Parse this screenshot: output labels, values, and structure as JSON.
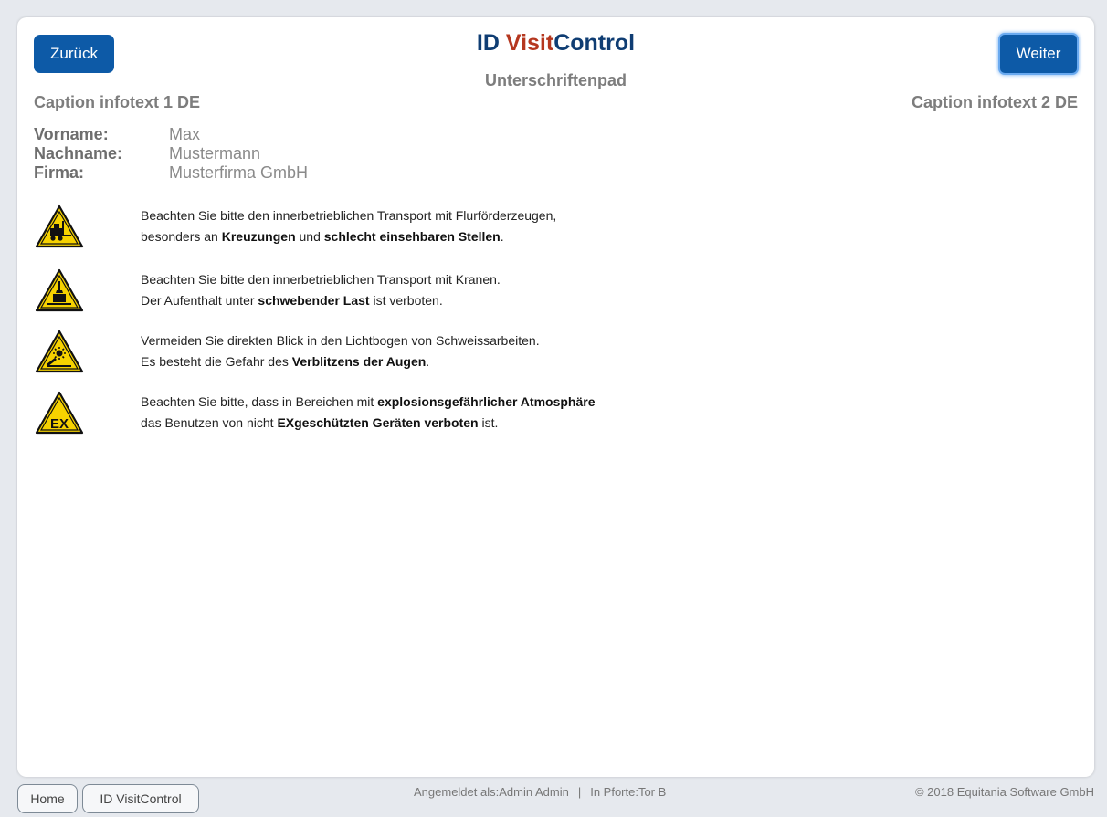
{
  "header": {
    "back_label": "Zurück",
    "next_label": "Weiter",
    "logo_part1": "ID ",
    "logo_part2": "Visit",
    "logo_part3": "Control",
    "subtitle": "Unterschriftenpad",
    "caption_left": "Caption infotext 1 DE",
    "caption_right": "Caption infotext 2 DE"
  },
  "person": {
    "first_name_label": "Vorname:",
    "first_name": "Max",
    "last_name_label": "Nachname:",
    "last_name": "Mustermann",
    "company_label": "Firma:",
    "company": "Musterfirma GmbH"
  },
  "warnings": [
    {
      "icon": "forklift-warning-icon",
      "line1": "Beachten Sie bitte den innerbetrieblichen Transport mit Flurförderzeugen,",
      "line2_pre": "besonders an ",
      "line2_b1": "Kreuzungen",
      "line2_mid": " und ",
      "line2_b2": "schlecht einsehbaren Stellen",
      "line2_post": "."
    },
    {
      "icon": "suspended-load-warning-icon",
      "line1": "Beachten Sie bitte den innerbetrieblichen Transport mit Kranen.",
      "line2_pre": "Der Aufenthalt unter ",
      "line2_b1": "schwebender Last",
      "line2_post": " ist verboten."
    },
    {
      "icon": "welding-arc-warning-icon",
      "line1": "Vermeiden Sie direkten Blick in den Lichtbogen von Schweissarbeiten.",
      "line2_pre": "Es besteht die Gefahr des ",
      "line2_b1": "Verblitzens der Augen",
      "line2_post": "."
    },
    {
      "icon": "explosive-atmosphere-warning-icon",
      "icon_text": "EX",
      "line1_pre": "Beachten Sie bitte, dass in Bereichen mit ",
      "line1_b": "explosionsgefährlicher Atmosphäre",
      "line2_pre": "das Benutzen von nicht ",
      "line2_b1": "EXgeschützten Geräten verboten",
      "line2_post": " ist."
    }
  ],
  "footer": {
    "home_label": "Home",
    "app_label": "ID VisitControl",
    "logged_in": "Angemeldet als:Admin Admin",
    "separator": "|",
    "gate": "In Pforte:Tor B",
    "copyright": "© 2018 Equitania Software GmbH"
  },
  "colors": {
    "primary_button": "#0d5aa7",
    "logo_dark": "#0f3d73",
    "logo_accent": "#b5371f",
    "warning_yellow": "#f6d200"
  }
}
